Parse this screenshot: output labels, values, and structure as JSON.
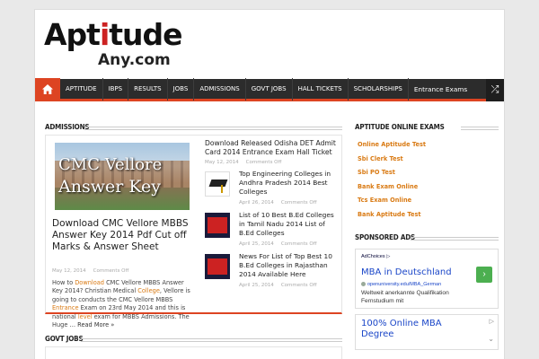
{
  "logo": {
    "line1_a": "Apt",
    "line1_b": "i",
    "line1_c": "tude",
    "line2": "Any.com"
  },
  "nav": {
    "items": [
      "APTITUDE",
      "IBPS",
      "RESULTS",
      "JOBS",
      "ADMISSIONS",
      "GOVT JOBS",
      "HALL TICKETS",
      "SCHOLARSHIPS",
      "Entrance Exams"
    ]
  },
  "admissions": {
    "title": "ADMISSIONS",
    "featured": {
      "image_text_1": "CMC Vellore",
      "image_text_2": "Answer Key",
      "title": "Download CMC Vellore MBBS Answer Key 2014 Pdf Cut off Marks & Answer Sheet",
      "date": "May 12, 2014",
      "comments": "Comments Off",
      "excerpt": {
        "p1": "How to ",
        "k1": "Download",
        "p2": " CMC Vellore MBBS Answer Key 2014? Christian Medical ",
        "k2": "College",
        "p3": ", Vellore is going to conducts the CMC Vellore MBBS ",
        "k3": "Entrance",
        "p4": " Exam on 23rd May 2014 and this is national ",
        "k4": "level",
        "p5": " exam for MBBS Admissions. The Huge … ",
        "more": "Read More »"
      }
    },
    "list": [
      {
        "title": "Download Released Odisha DET Admit Card 2014 Entrance Exam Hall Ticket",
        "date": "May 12, 2014",
        "comments": "Comments Off"
      },
      {
        "title": "Top Engineering Colleges in Andhra Pradesh 2014 Best Colleges",
        "date": "April 26, 2014",
        "comments": "Comments Off"
      },
      {
        "title": "List of 10 Best B.Ed Colleges in Tamil Nadu 2014 List of B.Ed Colleges",
        "date": "April 25, 2014",
        "comments": "Comments Off"
      },
      {
        "title": "News For List of Top Best 10 B.Ed Colleges in Rajasthan 2014 Available Here",
        "date": "April 25, 2014",
        "comments": "Comments Off"
      }
    ]
  },
  "govt_jobs": {
    "title": "GOVT JOBS"
  },
  "sidebar": {
    "exams_title": "APTITUDE ONLINE EXAMS",
    "exams": [
      "Online Aptitude Test",
      "Sbi Clerk Test",
      "Sbi PO Test",
      "Bank Exam Online",
      "Tcs Exam Online",
      "Bank Aptitude Test"
    ],
    "ads_title": "SPONSORED ADS",
    "ad1": {
      "choices": "AdChoices ▷",
      "headline": "MBA in Deutschland",
      "url": "openuniversity.edu/MBA_German",
      "desc": "Weltweit anerkannte Qualifikation Fernstudium mit"
    },
    "ad2": {
      "headline": "100% Online MBA Degree"
    }
  },
  "colors": {
    "accent": "#d42",
    "link_orange": "#d97a13",
    "nav_bg": "#2c2c2c"
  }
}
